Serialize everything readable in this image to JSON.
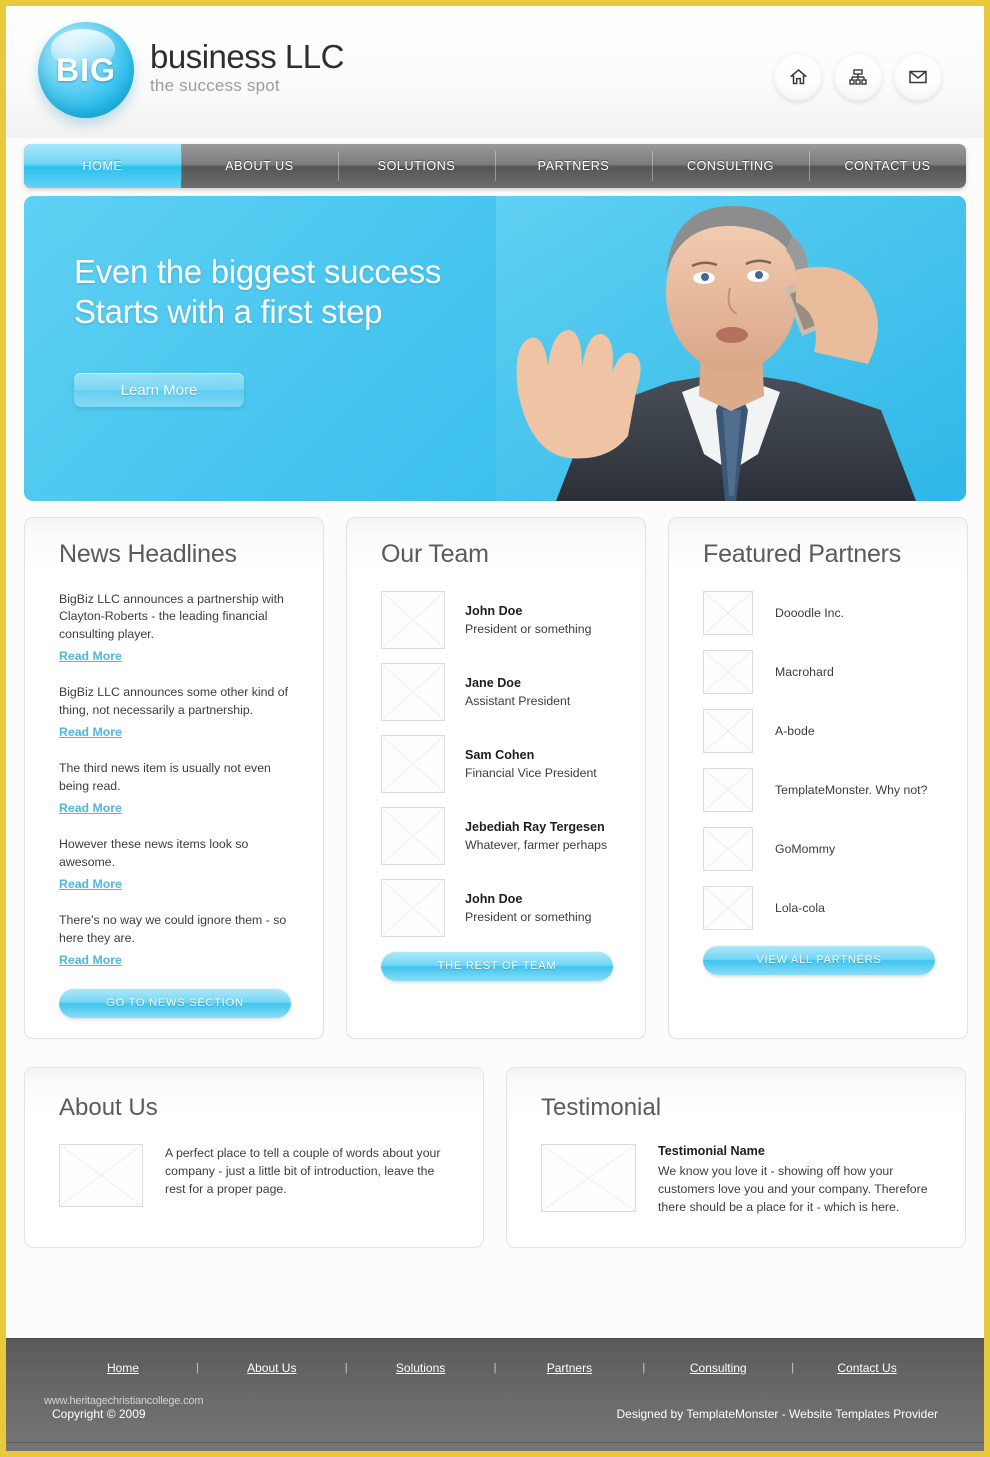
{
  "brand": {
    "orb_text": "BIG",
    "title": "business LLC",
    "tagline": "the success spot"
  },
  "header": {
    "icons": [
      {
        "name": "home-icon",
        "label": "Home"
      },
      {
        "name": "sitemap-icon",
        "label": "Sitemap"
      },
      {
        "name": "mail-icon",
        "label": "Contact"
      }
    ]
  },
  "nav": {
    "items": [
      {
        "label": "HOME",
        "active": true
      },
      {
        "label": "ABOUT US",
        "active": false
      },
      {
        "label": "SOLUTIONS",
        "active": false
      },
      {
        "label": "PARTNERS",
        "active": false
      },
      {
        "label": "CONSULTING",
        "active": false
      },
      {
        "label": "CONTACT US",
        "active": false
      }
    ]
  },
  "hero": {
    "line1": "Even the biggest success",
    "line2": "Starts with a first step",
    "button": "Learn More"
  },
  "news": {
    "title": "News Headlines",
    "items": [
      {
        "text": "BigBiz LLC announces a partnership with Clayton-Roberts - the leading financial consulting player.",
        "link": "Read More"
      },
      {
        "text": "BigBiz LLC announces some other kind of thing, not necessarily a partnership.",
        "link": "Read More"
      },
      {
        "text": "The third news item is usually not even being read.",
        "link": "Read More"
      },
      {
        "text": "However these news items look so awesome.",
        "link": "Read More"
      },
      {
        "text": "There's no way  we could ignore them - so here they are.",
        "link": "Read More"
      }
    ],
    "cta": "GO TO NEWS SECTION"
  },
  "team": {
    "title": "Our Team",
    "members": [
      {
        "name": "John Doe",
        "role": "President or something"
      },
      {
        "name": "Jane Doe",
        "role": "Assistant President"
      },
      {
        "name": "Sam Cohen",
        "role": "Financial Vice President"
      },
      {
        "name": "Jebediah Ray Tergesen",
        "role": "Whatever, farmer perhaps"
      },
      {
        "name": "John Doe",
        "role": "President or something"
      }
    ],
    "cta": "THE REST OF TEAM"
  },
  "partners": {
    "title": "Featured Partners",
    "items": [
      {
        "name": "Dooodle Inc."
      },
      {
        "name": "Macrohard"
      },
      {
        "name": "A-bode"
      },
      {
        "name": "TemplateMonster. Why not?"
      },
      {
        "name": "GoMommy"
      },
      {
        "name": "Lola-cola"
      }
    ],
    "cta": "VIEW ALL PARTNERS"
  },
  "about": {
    "title": "About Us",
    "text": "A perfect place to tell a couple of words about your company - just a little bit of introduction, leave the rest for a proper page."
  },
  "testimonial": {
    "title": "Testimonial",
    "name": "Testimonial Name",
    "text": "We know you love it - showing off how your customers love you and your company. Therefore there should be a place for it - which is here."
  },
  "footer": {
    "links": [
      {
        "label": "Home"
      },
      {
        "label": "About Us"
      },
      {
        "label": "Solutions"
      },
      {
        "label": "Partners"
      },
      {
        "label": "Consulting"
      },
      {
        "label": "Contact Us"
      }
    ],
    "separator": "|",
    "copyright": "Copyright © 2009",
    "designed": "Designed by TemplateMonster - Website Templates Provider",
    "watermark": "www.heritagechristiancollege.com"
  },
  "colors": {
    "accent": "#3ec4ee",
    "page_border": "#e8c93c",
    "nav_gray": "#7d7d7d",
    "footer_gray": "#6b6b6b",
    "link_blue": "#4fb9d8"
  }
}
